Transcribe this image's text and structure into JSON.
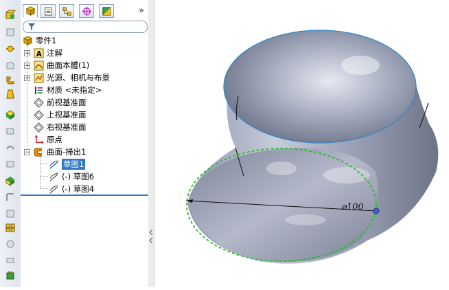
{
  "feature_tree": {
    "root_label": "零件1",
    "items": [
      {
        "label": "注解",
        "expandable": true,
        "icon": "annotations-icon"
      },
      {
        "label": "曲面本體(1)",
        "expandable": true,
        "icon": "surface-bodies-icon"
      },
      {
        "label": "光源、相机与布景",
        "expandable": true,
        "icon": "lights-cameras-scene-icon"
      },
      {
        "label": "材质 <未指定>",
        "expandable": false,
        "icon": "material-icon"
      },
      {
        "label": "前视基准面",
        "expandable": false,
        "icon": "plane-icon"
      },
      {
        "label": "上视基准面",
        "expandable": false,
        "icon": "plane-icon"
      },
      {
        "label": "右视基准面",
        "expandable": false,
        "icon": "plane-icon"
      },
      {
        "label": "原点",
        "expandable": false,
        "icon": "origin-icon"
      },
      {
        "label": "曲面-掃出1",
        "expandable": true,
        "expanded": true,
        "icon": "sweep-surface-icon"
      }
    ],
    "children": [
      {
        "label": "草图1",
        "selected": true,
        "icon": "sketch-icon"
      },
      {
        "label": "(-) 草图6",
        "selected": false,
        "icon": "sketch-icon"
      },
      {
        "label": "(-) 草图4",
        "selected": false,
        "icon": "sketch-icon"
      }
    ]
  },
  "panel_tabs": [
    "feature-manager-tab",
    "property-manager-tab",
    "configuration-manager-tab",
    "dimxpert-tab",
    "display-manager-tab"
  ],
  "expand_label": "»",
  "viewport": {
    "dimension_text": "⌀100"
  },
  "colors": {
    "selection": "#3178c6",
    "sketch_green": "#1fc21f",
    "edge_blue": "#2f86c8",
    "surface": "#9aa1b5"
  }
}
